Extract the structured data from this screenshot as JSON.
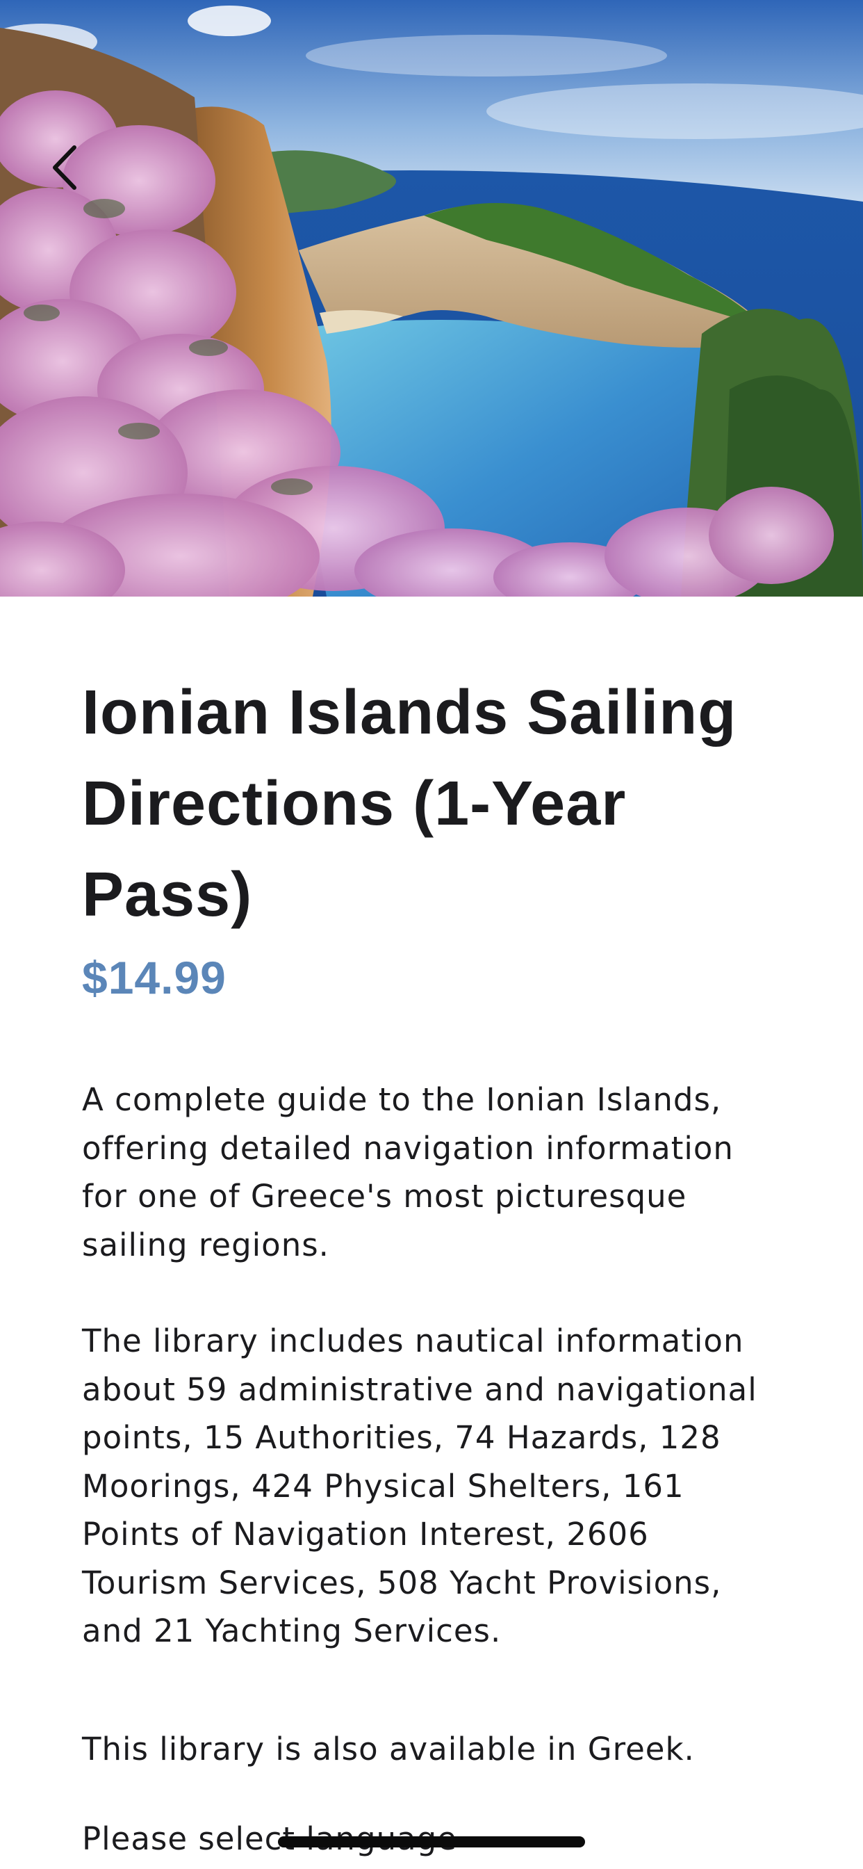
{
  "header": {
    "image_icon": "coastal-landscape-image",
    "back_icon": "chevron-left-icon"
  },
  "product": {
    "title": "Ionian Islands Sailing Directions (1-Year Pass)",
    "price": "$14.99",
    "price_color": "#5b86b8"
  },
  "description": {
    "paragraph1": "A complete guide to the Ionian Islands, offering detailed navigation information for one of Greece's most picturesque sailing regions.",
    "paragraph2": "The library includes nautical information about 59 administrative and navigational points, 15 Authorities, 74 Hazards, 128 Moorings, 424 Physical Shelters, 161 Points of Navigation Interest, 2606 Tourism Services, 508 Yacht Provisions, and 21 Yachting Services.",
    "paragraph3": "This library is also available in Greek.",
    "paragraph4": "Please select language"
  }
}
